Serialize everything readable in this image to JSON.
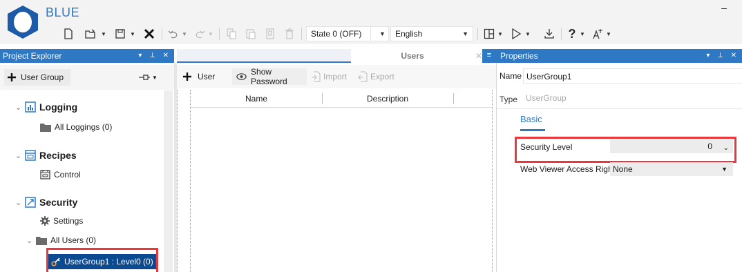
{
  "app": {
    "title": "BLUE",
    "minimize_glyph": "–"
  },
  "toolbar": {
    "state_combo": "State 0 (OFF)",
    "language_combo": "English",
    "help_glyph": "?"
  },
  "project_explorer": {
    "header": "Project Explorer",
    "header_buttons": "▾ ⊥ ✕",
    "add_button": "User Group",
    "tree": {
      "logging": {
        "label": "Logging",
        "child": "All Loggings (0)"
      },
      "recipes": {
        "label": "Recipes",
        "child": "Control"
      },
      "security": {
        "label": "Security",
        "settings": "Settings",
        "all_users": "All Users (0)",
        "selected_group": "UserGroup1 : Level0 (0)"
      }
    }
  },
  "users": {
    "tab_label": "Users",
    "buttons": {
      "add_user": "User",
      "show_password": "Show Password",
      "import": "Import",
      "export": "Export"
    },
    "columns": [
      "Name",
      "Description"
    ]
  },
  "properties": {
    "header": "Properties",
    "header_buttons": "▾ ⊥ ✕",
    "name_label": "Name",
    "name_value": "UserGroup1",
    "type_label": "Type",
    "type_value": "UserGroup",
    "tab_basic": "Basic",
    "security_level_label": "Security Level",
    "security_level_value": "0",
    "web_viewer_label": "Web Viewer Access Right",
    "web_viewer_value": "None"
  },
  "colors": {
    "accent": "#2f79c4",
    "selection": "#0b4a91",
    "highlight_box": "#e8383d"
  }
}
